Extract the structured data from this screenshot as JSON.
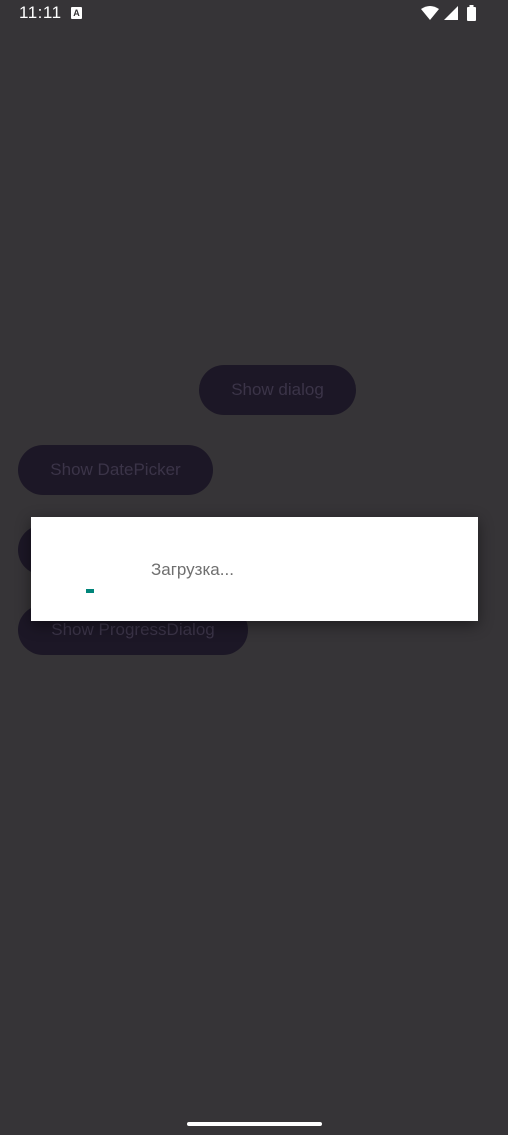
{
  "status_bar": {
    "time": "11:11",
    "notification_icon": "a-icon",
    "icons": [
      "wifi-icon",
      "cell-signal-icon",
      "battery-icon"
    ]
  },
  "buttons": {
    "show_dialog": "Show dialog",
    "show_datepicker": "Show DatePicker",
    "show_progress_dialog": "Show ProgressDialog"
  },
  "dialog": {
    "message": "Загрузка...",
    "spinner_color": "#00857a"
  },
  "colors": {
    "background": "#363437",
    "button_background": "#1c1726",
    "dialog_background": "#ffffff"
  }
}
